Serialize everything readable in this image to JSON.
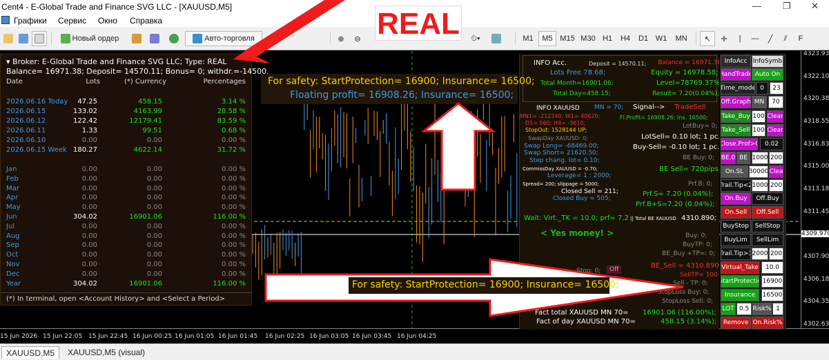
{
  "window": {
    "title": "Cent4 - E-Global Trade and Finance SVG LLC - [XAUUSD,M5]",
    "minimize": "—",
    "maximize": "❐",
    "close": "✕"
  },
  "menu": {
    "items": [
      "Графики",
      "Сервис",
      "Окно",
      "Справка"
    ]
  },
  "toolbar": {
    "new_order": "Новый ордер",
    "auto_trading": "Авто-торговля",
    "timeframes": [
      "M1",
      "M5",
      "M15",
      "M30",
      "H1",
      "H4",
      "D1",
      "W1",
      "MN"
    ],
    "active_timeframe": "M5"
  },
  "banner": {
    "text": "REAL",
    "color": "#ee1c1c"
  },
  "account_panel": {
    "header": "Broker:  E-Global Trade and Finance SVG LLC;  Type: REAL",
    "balances": "Balance= 16971.38; Deposit= 14570.11; Bonus= 0; withdr.=-14500.",
    "columns": [
      "Date",
      "Lots",
      "(*)  Currency",
      "Percentages"
    ],
    "days": [
      {
        "date": "2026.06.16 Today",
        "lots": "47.25",
        "currency": "458.15",
        "percent": "3.14 %"
      },
      {
        "date": "2026.06.15",
        "lots": "133.02",
        "currency": "4163.99",
        "percent": "28.58 %"
      },
      {
        "date": "2026.06.12",
        "lots": "122.42",
        "currency": "12179.41",
        "percent": "83.59 %"
      },
      {
        "date": "2026.06.11",
        "lots": "1.33",
        "currency": "99.51",
        "percent": "0.68 %"
      },
      {
        "date": "2026.06.10",
        "lots": "0.00",
        "currency": "0.00",
        "percent": "0.00 %"
      },
      {
        "date": "2026.06.15 Week",
        "lots": "180.27",
        "currency": "4622.14",
        "percent": "31.72 %"
      }
    ],
    "months": [
      {
        "date": "Jan",
        "lots": "0.00",
        "currency": "0.00",
        "percent": "0.00 %"
      },
      {
        "date": "Feb",
        "lots": "0.00",
        "currency": "0.00",
        "percent": "0.00 %"
      },
      {
        "date": "Mar",
        "lots": "0.00",
        "currency": "0.00",
        "percent": "0.00 %"
      },
      {
        "date": "Apr",
        "lots": "0.00",
        "currency": "0.00",
        "percent": "0.00 %"
      },
      {
        "date": "May",
        "lots": "0.00",
        "currency": "0.00",
        "percent": "0.00 %"
      },
      {
        "date": "Jun",
        "lots": "304.02",
        "currency": "16901.06",
        "percent": "116.00 %"
      },
      {
        "date": "Jul",
        "lots": "0.00",
        "currency": "0.00",
        "percent": "0.00 %"
      },
      {
        "date": "Aug",
        "lots": "0.00",
        "currency": "0.00",
        "percent": "0.00 %"
      },
      {
        "date": "Sep",
        "lots": "0.00",
        "currency": "0.00",
        "percent": "0.00 %"
      },
      {
        "date": "Oct",
        "lots": "0.00",
        "currency": "0.00",
        "percent": "0.00 %"
      },
      {
        "date": "Nov",
        "lots": "0.00",
        "currency": "0.00",
        "percent": "0.00 %"
      },
      {
        "date": "Dec",
        "lots": "0.00",
        "currency": "0.00",
        "percent": "0.00 %"
      },
      {
        "date": "Year",
        "lots": "304.02",
        "currency": "16901.06",
        "percent": "116.00 %"
      }
    ],
    "footer": "(*) In terminal, open <Account History> and <Select a Period>"
  },
  "safety_top": {
    "line1": "For safety: StartProtection= 16900; Insurance= 16500;",
    "line2": "Floating profit= 16908.26; Insurance= 16500;"
  },
  "safety_bottom": "For safety: StartProtection= 16900; Insurance= 16500;",
  "info_panel": {
    "info_acc": "INFO Acc.",
    "deposit": "Deposit = 14570.11;",
    "balance": "Balance = 16971.38;",
    "lots_free": "Lots Free 78.68;",
    "equity": "Equity = 16978.58;",
    "total_month": "Total Month=16901.06;",
    "level": "Level=78769.37%;",
    "total_day": "Total Day=458.15;",
    "result": "Result= 7.20(0.04%);",
    "info_sym": "INFO XAUUSD",
    "mn": "MN = 70;",
    "signal": "Signal-->",
    "trade_sell": "TradeSell",
    "mn1": "MN1= -212240;  W1= 40620;",
    "d1": "D1= 560;   H4= -3610;",
    "stopout": "StopOut: 1528144 UP;",
    "swapday": "SwapDay XAUUSD:  0;",
    "swap_long": "Swap Long= -68469.00;",
    "swap_short": "Swap Short= 21620.50;",
    "step": "Step chang. lot= 0.10;",
    "commission": "CommissDay XAUUSD = -0.70;",
    "leverage": "Leverage= 1 : 2000;",
    "spread": "Spread= 200;  slippage = 5000;",
    "closed_sell": "Closed  Sell = 211;",
    "closed_buy": "Closed  Buy = 505;",
    "fl_profit": "Fl.Profit=  16908.26;   Ins. 16500;",
    "lotbuy": "LotBuy= 0;",
    "lotsell": "LotSell= 0.10 lot; 1 pc.",
    "buysell": "Buy-Sell= -0.10 lot; 1 pc.",
    "be_buy": "BE Buy: 0;",
    "be_sell": "BE Sell= 720pips;",
    "prf_b": "Prf.B: 0;",
    "prf_s": "Prf.S= 7.20 (0.04%);",
    "prf_bs": "Prf.B+S=7.20 (0.04%);",
    "wait": "Wait: Virt._TK = 10.0; prf= 7.2",
    "total_be": "|| Total BE XAUUSD",
    "total_be_val": "4310.890;",
    "yes_money": "< Yes money! >",
    "buy_tp": "Buy: 0;",
    "buytp": "BuyTP: 0;",
    "be_buy_tp": "BE_Buy +TP=: 0;",
    "stop0": "Stop: 0;",
    "off": "Off",
    "be_sell_price": "BE_Sell = 4310.890",
    "selltp": "SellTP= 100",
    "sell_tp": "Sell - TP: 0;",
    "stoploss_buy": "StopLoss Buy: 0;",
    "stoploss_sell": "StopLoss Sell: 0;",
    "fact_total": "Fact total   XAUUSD MN 70=",
    "fact_total_val": "16901.06 (116.00%);",
    "fact_day": "Fact of day XAUUSD MN 70=",
    "fact_day_val": "458.15 (3.14%);"
  },
  "buttons": {
    "info_acc": "InfoAcc",
    "info_symb": "InfoSymb",
    "hand_trade": "HandTrade",
    "auto_on": "Auto On",
    "time_mode": "Time_mode",
    "time_a": "0",
    "time_b": "23",
    "off_graph": "Off.Graph",
    "mn": "MN",
    "mn_val": "70",
    "take_buy": "Take_Buy",
    "take_buy_val": "100",
    "clear1": "Clear",
    "take_sell": "Take_Sell",
    "take_sell_val": "100",
    "clear2": "Clear",
    "close_prof": "Close.Prof>0",
    "close_prof_val": "0.02",
    "be0": "BE.0",
    "be": "BE",
    "be_val1": "1000",
    "be_val2": "200",
    "on_sl": "On.SL",
    "on_sl_val": "30000",
    "clear3": "Clea",
    "trail_tip2": "Trail.Tip<2",
    "trail_val1": "1000",
    "trail_val2": "200",
    "on_buy": "On.Buy",
    "off_buy": "Off.Buy",
    "on_sell": "On.Sell",
    "off_sell": "Off.Sell",
    "buy_stop": "BuyStop",
    "sell_stop": "SellStop",
    "buy_lim": "BuyLim",
    "sell_lim": "SellLim",
    "trail_tip1": "Trail.Tip>1",
    "trail1_val1": "2000",
    "trail1_val2": "200",
    "virtual_take": "Virtual_Take",
    "virtual_take_val": "10.0",
    "start_protection": "StartProtectio",
    "start_protection_val": "16900",
    "insurance": "Insurance",
    "insurance_val": "16500",
    "lot": "LOT",
    "lot_val": "0.5",
    "risk": "Risk%",
    "risk_val": "1",
    "remove": "Remove",
    "on_risk": "On.Risk%"
  },
  "price_axis": [
    "4323.930",
    "4322.105",
    "4320.380",
    "4318.555",
    "4316.830",
    "4315.005",
    "4313.180",
    "4311.455",
    "4309.970",
    "4307.905",
    "4306.180",
    "4304.355",
    "4302.630"
  ],
  "time_axis": [
    "15 Jun 2026",
    "15 Jun 22:05",
    "15 Jun 22:45",
    "16 Jun 00:25",
    "16 Jun 01:05",
    "16 Jun 01:45",
    "16 Jun 02:25",
    "16 Jun 03:05",
    "16 Jun 03:45",
    "16 Jun 04:25"
  ],
  "tabs": [
    "XAUUSD,M5",
    "XAUUSD,M5 (visual)"
  ]
}
